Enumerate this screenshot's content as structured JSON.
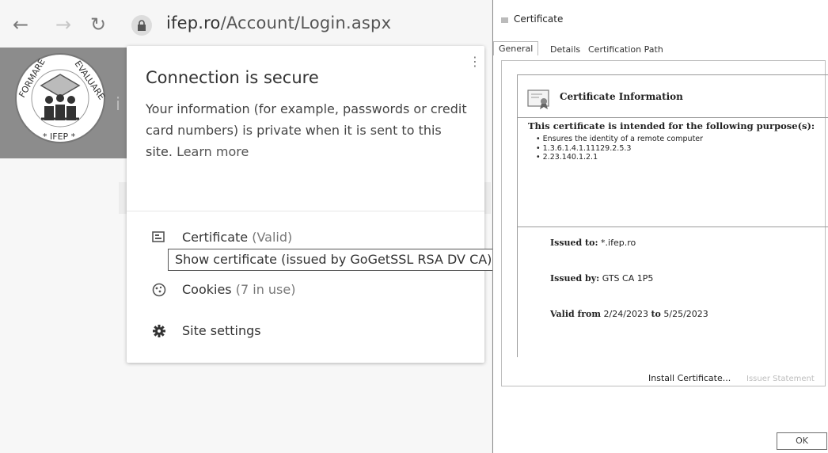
{
  "browser": {
    "url_host": "ifep.ro",
    "url_path": "/Account/Login.aspx",
    "banner_letter": "i",
    "logo_text": {
      "top": "FORMARE",
      "right": "EVALUARE",
      "bottom": "IFEP"
    }
  },
  "popup": {
    "title": "Connection is secure",
    "description": "Your information (for example, passwords or credit card numbers) is private when it is sent to this site.",
    "learn_more": "Learn more",
    "certificate_label": "Certificate",
    "certificate_status": "(Valid)",
    "tooltip": "Show certificate (issued by GoGetSSL RSA DV CA)",
    "cookies_label": "Cookies",
    "cookies_status": "(7 in use)",
    "site_settings": "Site settings"
  },
  "certificate": {
    "window_title": "Certificate",
    "tabs": [
      "General",
      "Details",
      "Certification Path"
    ],
    "info_title": "Certificate Information",
    "purpose_heading": "This certificate is intended for the following purpose(s):",
    "purposes": [
      "Ensures the identity of a remote computer",
      "1.3.6.1.4.1.11129.2.5.3",
      "2.23.140.1.2.1"
    ],
    "issued_to_label": "Issued to:",
    "issued_to": "*.ifep.ro",
    "issued_by_label": "Issued by:",
    "issued_by": "GTS CA 1P5",
    "valid_from_label": "Valid from",
    "valid_from": "2/24/2023",
    "to_label": "to",
    "valid_to": "5/25/2023",
    "install_button": "Install Certificate...",
    "issuer_statement_button": "Issuer Statement",
    "ok_button": "OK"
  }
}
